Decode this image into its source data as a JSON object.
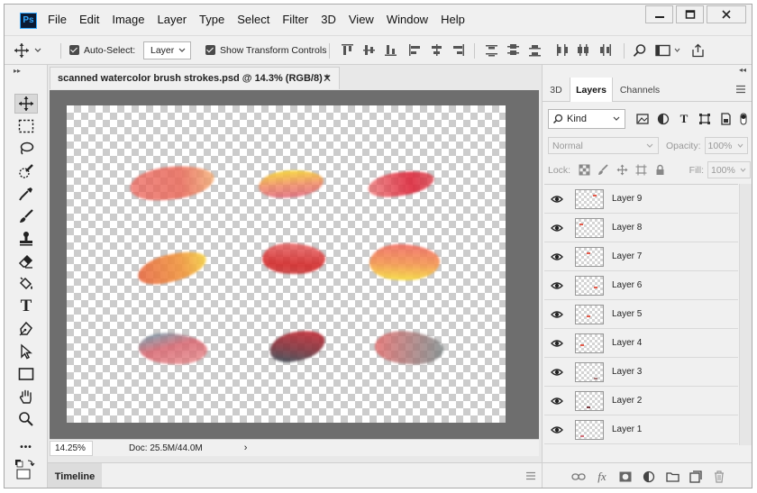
{
  "app": {
    "logo": "Ps",
    "menu": [
      "File",
      "Edit",
      "Image",
      "Layer",
      "Type",
      "Select",
      "Filter",
      "3D",
      "View",
      "Window",
      "Help"
    ],
    "window_controls": [
      "minimize-icon",
      "maximize-icon",
      "close-icon"
    ]
  },
  "options_bar": {
    "auto_select_label": "Auto-Select:",
    "auto_select_checked": true,
    "auto_select_target": "Layer",
    "show_transform_label": "Show Transform Controls",
    "show_transform_checked": true
  },
  "document": {
    "tab_title": "scanned watercolor brush strokes.psd @ 14.3% (RGB/8) *",
    "zoom": "14.25%",
    "doc_size": "Doc: 25.5M/44.0M",
    "status_arrow": "›"
  },
  "timeline": {
    "label": "Timeline"
  },
  "panel": {
    "tabs": [
      {
        "label": "3D",
        "active": false
      },
      {
        "label": "Layers",
        "active": true
      },
      {
        "label": "Channels",
        "active": false
      }
    ],
    "filter_kind": "Kind",
    "blend_mode": "Normal",
    "opacity_label": "Opacity:",
    "opacity_value": "100%",
    "lock_label": "Lock:",
    "fill_label": "Fill:",
    "fill_value": "100%",
    "layers": [
      {
        "name": "Layer 9"
      },
      {
        "name": "Layer 8"
      },
      {
        "name": "Layer 7"
      },
      {
        "name": "Layer 6"
      },
      {
        "name": "Layer 5"
      },
      {
        "name": "Layer 4"
      },
      {
        "name": "Layer 3"
      },
      {
        "name": "Layer 2"
      },
      {
        "name": "Layer 1"
      }
    ],
    "footer_icons": [
      "link-icon",
      "fx-icon",
      "mask-icon",
      "adjustment-icon",
      "folder-icon",
      "new-layer-icon",
      "trash-icon"
    ],
    "footer_fx": "fx"
  },
  "tools": [
    "move-icon",
    "marquee-icon",
    "lasso-icon",
    "quick-select-icon",
    "eyedropper-icon",
    "brush-icon",
    "stamp-icon",
    "eraser-icon",
    "bucket-icon",
    "type-icon",
    "pen-icon",
    "path-select-icon",
    "rectangle-icon",
    "hand-icon",
    "zoom-icon",
    "more-icon",
    "color-swatches-icon"
  ],
  "type_tool_glyph": "T",
  "more_tool_glyph": "•••",
  "colors": {
    "accent_blue": "#31a8ff",
    "ps_logo_bg": "#0a1a33",
    "canvas_surround": "#6e6e6e"
  }
}
